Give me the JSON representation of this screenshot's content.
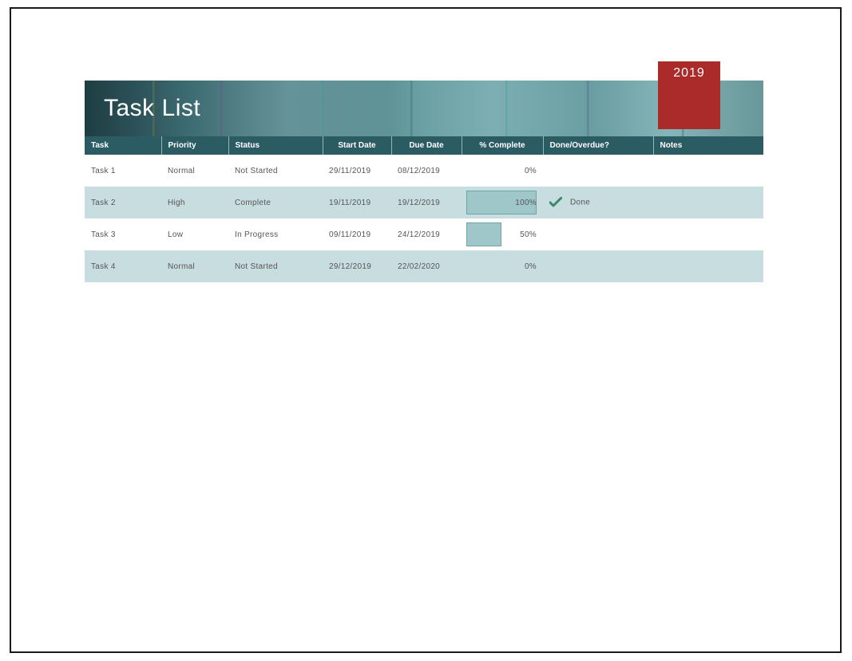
{
  "year": "2019",
  "title": "Task List",
  "columns": {
    "task": "Task",
    "priority": "Priority",
    "status": "Status",
    "start_date": "Start Date",
    "due_date": "Due Date",
    "pct_complete": "% Complete",
    "done_overdue": "Done/Overdue?",
    "notes": "Notes"
  },
  "rows": [
    {
      "task": "Task 1",
      "priority": "Normal",
      "status": "Not Started",
      "start_date": "29/11/2019",
      "due_date": "08/12/2019",
      "pct": 0,
      "pct_label": "0%",
      "done": "",
      "has_check": false,
      "notes": ""
    },
    {
      "task": "Task 2",
      "priority": "High",
      "status": "Complete",
      "start_date": "19/11/2019",
      "due_date": "19/12/2019",
      "pct": 100,
      "pct_label": "100%",
      "done": "Done",
      "has_check": true,
      "notes": ""
    },
    {
      "task": "Task 3",
      "priority": "Low",
      "status": "In Progress",
      "start_date": "09/11/2019",
      "due_date": "24/12/2019",
      "pct": 50,
      "pct_label": "50%",
      "done": "",
      "has_check": false,
      "notes": ""
    },
    {
      "task": "Task 4",
      "priority": "Normal",
      "status": "Not Started",
      "start_date": "29/12/2019",
      "due_date": "22/02/2020",
      "pct": 0,
      "pct_label": "0%",
      "done": "",
      "has_check": false,
      "notes": ""
    }
  ]
}
